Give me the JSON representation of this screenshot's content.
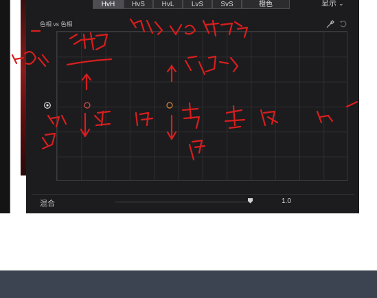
{
  "tabs": [
    {
      "label": "HvH",
      "active": true
    },
    {
      "label": "HvS",
      "active": false
    },
    {
      "label": "HvL",
      "active": false
    },
    {
      "label": "LvS",
      "active": false
    },
    {
      "label": "SvS",
      "active": false
    },
    {
      "label": "橙色",
      "active": false
    }
  ],
  "display_menu": {
    "label": "显示"
  },
  "curve_panel": {
    "title": "色相 vs 色相"
  },
  "blend": {
    "label": "混合",
    "value": "1.0",
    "level": 1.0
  },
  "icons": {
    "eyedropper": "eyedropper-icon",
    "reset": "reset-icon",
    "chevron": "chevron-down-icon",
    "pin": "target-icon"
  },
  "colors": {
    "panel_bg": "#1c1c1e",
    "ink": "#d81e1e",
    "bottom_bar": "#3b4450"
  }
}
